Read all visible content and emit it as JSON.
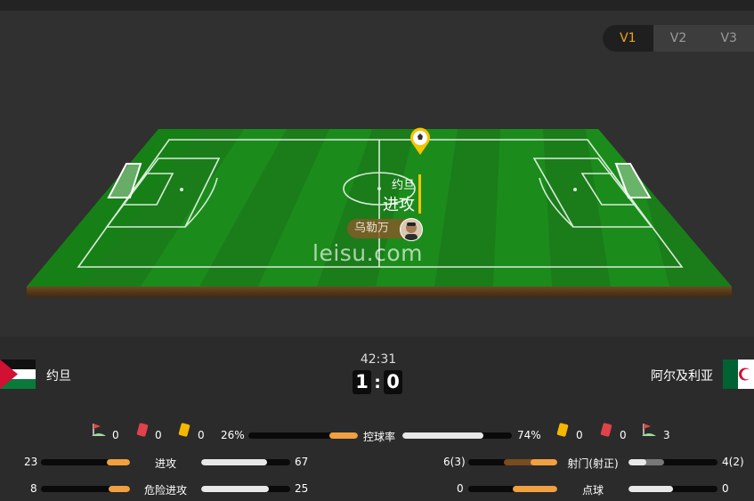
{
  "version_tabs": [
    "V1",
    "V2",
    "V3"
  ],
  "active_tab": "V1",
  "pitch": {
    "watermark": "leisu.com",
    "event_team": "约旦",
    "event_action": "进攻",
    "player_name": "乌勒万"
  },
  "match": {
    "clock": "42:31",
    "home_team": "约旦",
    "away_team": "阿尔及利亚",
    "home_score": "1",
    "away_score": "0"
  },
  "cards": {
    "home_corners": "0",
    "home_red": "0",
    "home_yellow": "0",
    "away_yellow": "0",
    "away_red": "0",
    "away_corners": "3"
  },
  "stats": {
    "possession": {
      "label": "控球率",
      "home": "26%",
      "away": "74%",
      "home_pct": 26,
      "away_pct": 74
    },
    "attacks": {
      "label": "进攻",
      "home": "23",
      "away": "67",
      "home_pct": 26,
      "away_pct": 74
    },
    "dangerous": {
      "label": "危险进攻",
      "home": "8",
      "away": "25",
      "home_pct": 24,
      "away_pct": 76
    },
    "shots": {
      "label": "射门(射正)",
      "home": "6(3)",
      "away": "4(2)",
      "home_pct": 60,
      "away_pct": 40
    },
    "penalties": {
      "label": "点球",
      "home": "0",
      "away": "0",
      "home_pct": 50,
      "away_pct": 50
    }
  },
  "colors": {
    "accent": "#f0a21b",
    "home_bar": "#f0a040",
    "away_bar": "#e8e8e8",
    "pitch_green": "#1e8a1e"
  }
}
